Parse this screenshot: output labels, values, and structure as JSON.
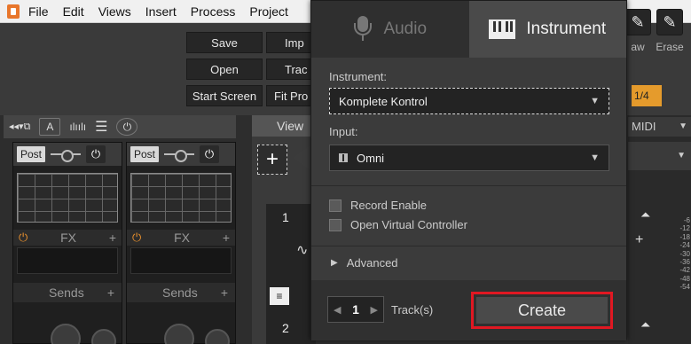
{
  "menu": [
    "File",
    "Edit",
    "Views",
    "Insert",
    "Process",
    "Project"
  ],
  "toolbar": {
    "save": "Save",
    "open": "Open",
    "start_screen": "Start Screen",
    "import": "Imp",
    "track": "Trac",
    "fit": "Fit Pro",
    "draw": "aw",
    "erase": "Erase",
    "snap": "1/4"
  },
  "mixer": {
    "post": "Post",
    "fx": "FX",
    "sends": "Sends"
  },
  "arrange": {
    "view_tab": "View",
    "add": "+",
    "track1": "1",
    "track2": "2"
  },
  "right": {
    "midi": "MIDI",
    "meter_scale": [
      "-6",
      "-12",
      "-18",
      "-24",
      "-30",
      "-36",
      "-42",
      "-48",
      "-54"
    ]
  },
  "popup": {
    "tab_audio": "Audio",
    "tab_instrument": "Instrument",
    "instrument_label": "Instrument:",
    "instrument_value": "Komplete Kontrol",
    "input_label": "Input:",
    "input_value": "Omni",
    "record_enable": "Record Enable",
    "open_virtual": "Open Virtual Controller",
    "advanced": "Advanced",
    "track_count": "1",
    "tracks_label": "Track(s)",
    "create": "Create"
  },
  "colors": {
    "accent_orange": "#e59b2c",
    "highlight_red": "#e01822"
  }
}
